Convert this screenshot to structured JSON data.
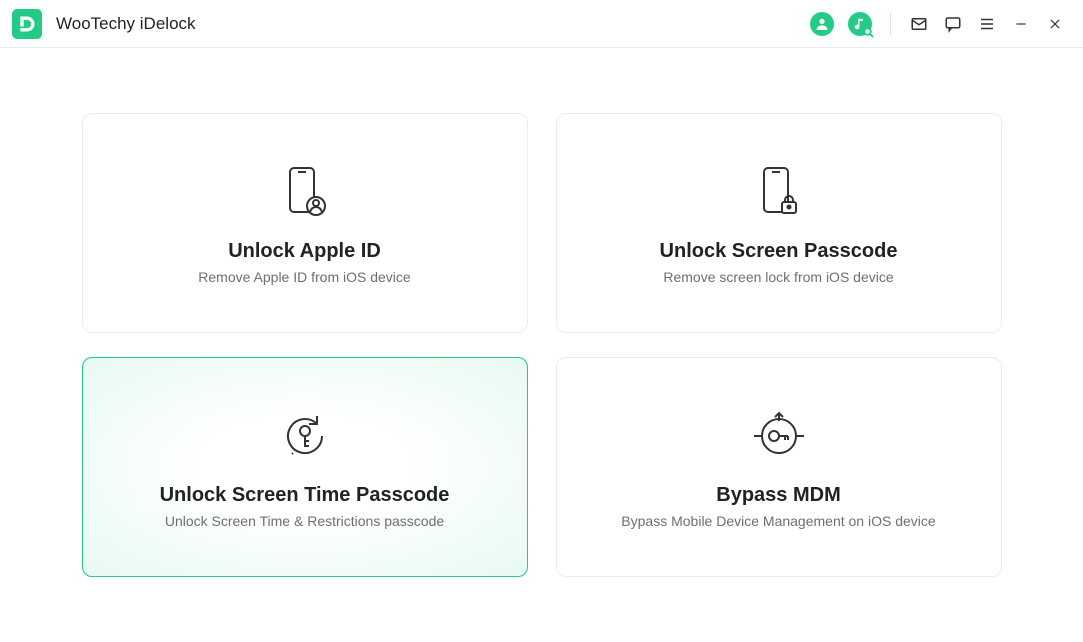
{
  "app": {
    "title": "WooTechy iDelock"
  },
  "cards": [
    {
      "title": "Unlock Apple ID",
      "desc": "Remove Apple ID from iOS device",
      "highlight": false
    },
    {
      "title": "Unlock Screen Passcode",
      "desc": "Remove screen lock from iOS device",
      "highlight": false
    },
    {
      "title": "Unlock Screen Time Passcode",
      "desc": "Unlock Screen Time & Restrictions passcode",
      "highlight": true
    },
    {
      "title": "Bypass MDM",
      "desc": "Bypass Mobile Device Management on iOS device",
      "highlight": false
    }
  ]
}
